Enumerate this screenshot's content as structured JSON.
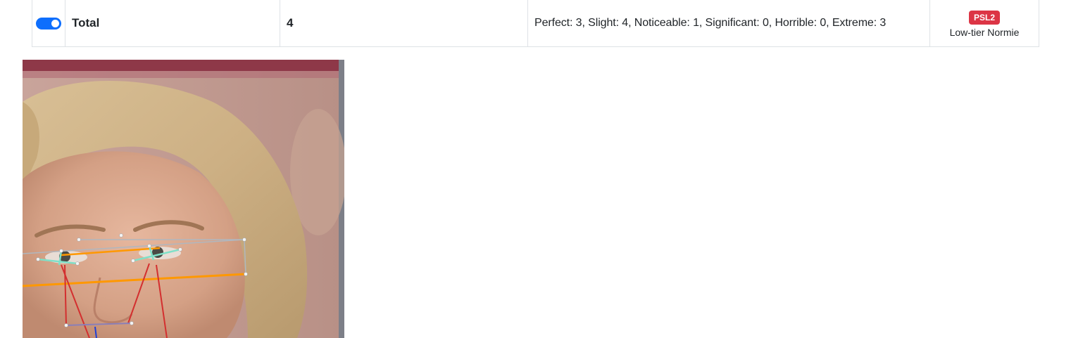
{
  "row": {
    "label": "Total",
    "value": "4",
    "counts": "Perfect: 3, Slight: 4, Noticeable: 1, Significant: 0, Horrible: 0, Extreme: 3",
    "badge": "PSL2",
    "tier": "Low-tier Normie",
    "toggle_on": true
  },
  "colors": {
    "toggle": "#0d6efd",
    "badge": "#dc3545",
    "landmark_eye": "#7fe0c8",
    "landmark_orange": "#ff9800",
    "landmark_red": "#d32f2f",
    "landmark_grey": "#b0b7bf"
  }
}
